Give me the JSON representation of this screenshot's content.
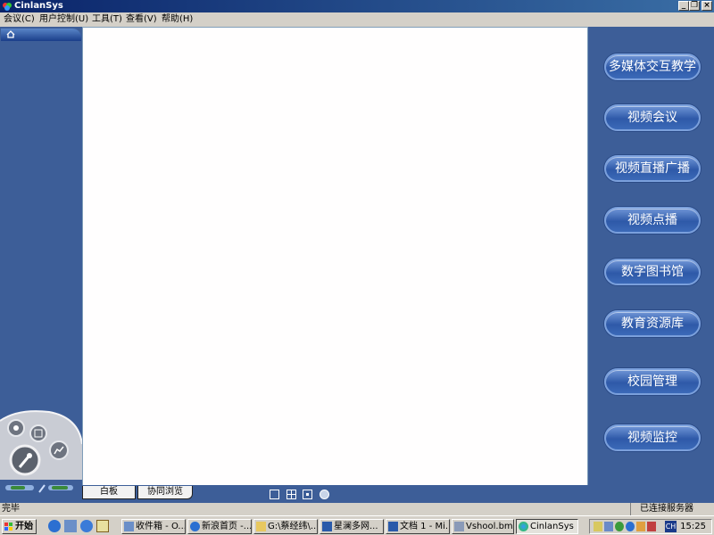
{
  "window": {
    "title": "CinlanSys"
  },
  "menu": [
    {
      "label": "会议(C)"
    },
    {
      "label": "用户控制(U)"
    },
    {
      "label": "工具(T)"
    },
    {
      "label": "查看(V)"
    },
    {
      "label": "帮助(H)"
    }
  ],
  "modules": [
    {
      "label": "多媒体交互教学"
    },
    {
      "label": "视频会议"
    },
    {
      "label": "视频直播广播"
    },
    {
      "label": "视频点播"
    },
    {
      "label": "数字图书馆"
    },
    {
      "label": "教育资源库"
    },
    {
      "label": "校园管理"
    },
    {
      "label": "视频监控"
    }
  ],
  "bottom_tabs": [
    {
      "label": "白板"
    },
    {
      "label": "协同浏览"
    }
  ],
  "status": {
    "left": "完毕",
    "right": "已连接服务器"
  },
  "taskbar": {
    "start": "开始",
    "tasks": [
      {
        "label": "收件箱 - O..."
      },
      {
        "label": "新浪首页 -..."
      },
      {
        "label": "G:\\蔡经纬\\..."
      },
      {
        "label": "星澜多网..."
      },
      {
        "label": "文档 1 - Mi..."
      },
      {
        "label": "Vshool.bmp..."
      },
      {
        "label": "CinlanSys"
      }
    ],
    "tray_lang": "CH",
    "clock": "15:25"
  },
  "colors": {
    "panel": "#3d5e98",
    "title_start": "#0a246a",
    "title_end": "#3a6ea5",
    "button": "#2e59a8"
  }
}
